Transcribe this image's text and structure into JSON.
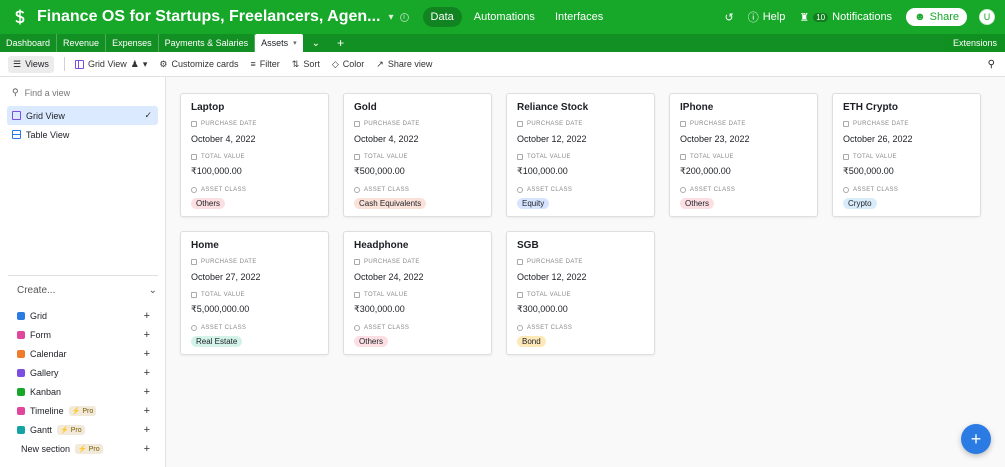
{
  "app": {
    "title": "Finance OS for Startups, Freelancers, Agen...",
    "mode_tabs": [
      "Data",
      "Automations",
      "Interfaces"
    ],
    "active_mode": "Data",
    "history_icon": "history-icon",
    "help_label": "Help",
    "notifications_label": "Notifications",
    "notifications_count": "10",
    "share_label": "Share",
    "avatar_initial": "U",
    "brand_color": "#17a82a"
  },
  "tables": {
    "tabs": [
      "Dashboard",
      "Revenue",
      "Expenses",
      "Payments & Salaries",
      "Assets"
    ],
    "active": "Assets",
    "extensions_label": "Extensions"
  },
  "toolbar": {
    "views_label": "Views",
    "view_name": "Grid View",
    "customize_label": "Customize cards",
    "filter_label": "Filter",
    "sort_label": "Sort",
    "color_label": "Color",
    "share_view_label": "Share view"
  },
  "sidebar": {
    "find_placeholder": "Find a view",
    "views": [
      {
        "label": "Grid View",
        "type": "grid",
        "active": true
      },
      {
        "label": "Table View",
        "type": "table",
        "active": false
      }
    ],
    "create_label": "Create...",
    "create_items": [
      {
        "label": "Grid",
        "color": "#2b7be4",
        "pro": false
      },
      {
        "label": "Form",
        "color": "#e0469b",
        "pro": false
      },
      {
        "label": "Calendar",
        "color": "#f07b2a",
        "pro": false
      },
      {
        "label": "Gallery",
        "color": "#7b4de0",
        "pro": false
      },
      {
        "label": "Kanban",
        "color": "#17a82a",
        "pro": false
      },
      {
        "label": "Timeline",
        "color": "#e0469b",
        "pro": true
      },
      {
        "label": "Gantt",
        "color": "#14a3a3",
        "pro": true
      }
    ],
    "new_section_label": "New section",
    "pro_label": "Pro"
  },
  "field_labels": {
    "date": "PURCHASE DATE",
    "value": "TOTAL VALUE",
    "class": "ASSET CLASS"
  },
  "cards": [
    {
      "title": "Laptop",
      "date": "October 4, 2022",
      "value": "₹100,000.00",
      "asset_class": "Others",
      "pill_color": "#fbdfe2"
    },
    {
      "title": "Gold",
      "date": "October 4, 2022",
      "value": "₹500,000.00",
      "asset_class": "Cash Equivalents",
      "pill_color": "#fbe2d9"
    },
    {
      "title": "Reliance Stock",
      "date": "October 12, 2022",
      "value": "₹100,000.00",
      "asset_class": "Equity",
      "pill_color": "#d6e4ff"
    },
    {
      "title": "IPhone",
      "date": "October 23, 2022",
      "value": "₹200,000.00",
      "asset_class": "Others",
      "pill_color": "#fbdfe2"
    },
    {
      "title": "ETH Crypto",
      "date": "October 26, 2022",
      "value": "₹500,000.00",
      "asset_class": "Crypto",
      "pill_color": "#d9ecfa"
    },
    {
      "title": "Home",
      "date": "October 27, 2022",
      "value": "₹5,000,000.00",
      "asset_class": "Real Estate",
      "pill_color": "#d3f2e8"
    },
    {
      "title": "Headphone",
      "date": "October 24, 2022",
      "value": "₹300,000.00",
      "asset_class": "Others",
      "pill_color": "#fbdfe2"
    },
    {
      "title": "SGB",
      "date": "October 12, 2022",
      "value": "₹300,000.00",
      "asset_class": "Bond",
      "pill_color": "#fde8b8"
    }
  ],
  "fab_icon": "plus-icon"
}
